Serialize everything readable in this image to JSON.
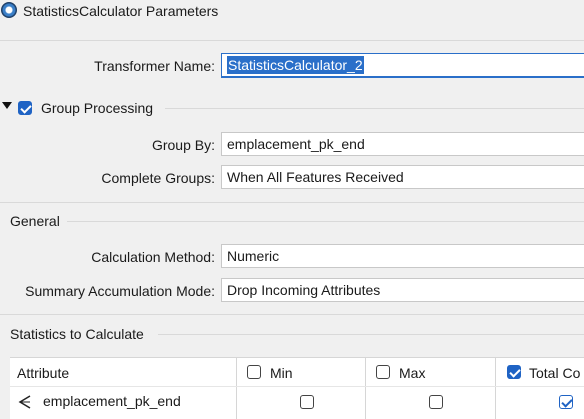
{
  "window": {
    "title": "StatisticsCalculator Parameters"
  },
  "transformer_name": {
    "label": "Transformer Name:",
    "value": "StatisticsCalculator_2"
  },
  "group_processing": {
    "label": "Group Processing",
    "checked": true,
    "group_by": {
      "label": "Group By:",
      "value": "emplacement_pk_end"
    },
    "complete_groups": {
      "label": "Complete Groups:",
      "value": "When All Features Received"
    }
  },
  "general": {
    "title": "General",
    "calculation_method": {
      "label": "Calculation Method:",
      "value": "Numeric"
    },
    "summary_mode": {
      "label": "Summary Accumulation Mode:",
      "value": "Drop Incoming Attributes"
    }
  },
  "statistics": {
    "title": "Statistics to Calculate",
    "columns": {
      "attribute": "Attribute",
      "min": "Min",
      "max": "Max",
      "total": "Total Co"
    },
    "rows": [
      {
        "attribute": "emplacement_pk_end",
        "min": false,
        "max": false,
        "total": true
      }
    ],
    "header_checks": {
      "min": false,
      "max": false,
      "total": true
    }
  },
  "colors": {
    "accent": "#1f63c4",
    "selection": "#2a6fc9",
    "background": "#f0f0f0"
  }
}
